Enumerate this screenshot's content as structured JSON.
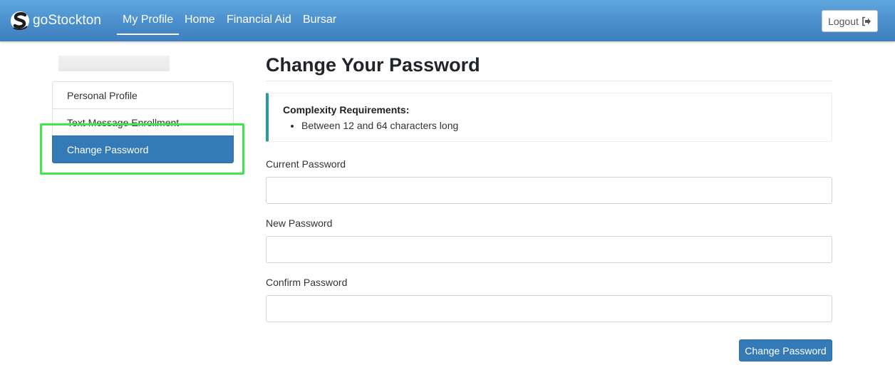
{
  "navbar": {
    "brand": "goStockton",
    "items": [
      {
        "label": "My Profile",
        "active": true
      },
      {
        "label": "Home"
      },
      {
        "label": "Financial Aid"
      },
      {
        "label": "Bursar"
      }
    ],
    "logout_label": "Logout",
    "logout_icon": "sign-out-icon"
  },
  "sidebar": {
    "items": [
      {
        "label": "Personal Profile"
      },
      {
        "label": "Text Message Enrollment"
      },
      {
        "label": "Change Password",
        "active": true
      }
    ]
  },
  "main": {
    "title": "Change Your Password",
    "requirements": {
      "heading": "Complexity Requirements:",
      "items": [
        "Between 12 and 64 characters long"
      ]
    },
    "fields": [
      {
        "label": "Current Password",
        "value": ""
      },
      {
        "label": "New Password",
        "value": ""
      },
      {
        "label": "Confirm Password",
        "value": ""
      }
    ],
    "submit_label": "Change Password"
  },
  "colors": {
    "navbar": "#4a8ecb",
    "primary": "#337ab7",
    "callout_accent": "#2b9aa4",
    "highlight": "#3ee84a"
  }
}
